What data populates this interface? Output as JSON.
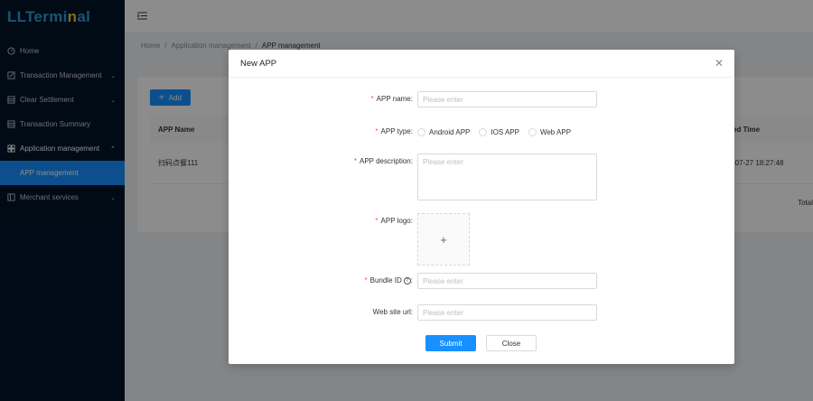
{
  "sidebar": {
    "logo_main": "LLTerminal",
    "items": [
      {
        "label": "Home",
        "icon": "dashboard-icon"
      },
      {
        "label": "Transaction Management",
        "icon": "edit-icon"
      },
      {
        "label": "Clear Settlement",
        "icon": "table-icon"
      },
      {
        "label": "Transaction Summary",
        "icon": "table-icon"
      },
      {
        "label": "Application management",
        "icon": "appstore-icon"
      },
      {
        "label": "APP management",
        "icon": ""
      },
      {
        "label": "Merchant services",
        "icon": "layout-icon"
      }
    ]
  },
  "breadcrumb": {
    "home": "Home",
    "parent": "Application management",
    "current": "APP management"
  },
  "toolbar": {
    "add_label": "Add"
  },
  "table": {
    "col_name": "APP Name",
    "col_time": "ed Time",
    "row_name": "扫码点餐111",
    "row_time": "-07-27 18:27:48",
    "total": "Total"
  },
  "modal": {
    "title": "New APP",
    "app_name_label": "APP name",
    "app_name_placeholder": "Please enter",
    "app_type_label": "APP type",
    "app_types": [
      "Android APP",
      "IOS APP",
      "Web APP"
    ],
    "description_label": "APP description",
    "description_placeholder": "Please enter",
    "logo_label": "APP logo",
    "bundle_label": "Bundle ID",
    "bundle_placeholder": "Please enter",
    "website_label": "Web site url",
    "website_placeholder": "Please enter",
    "submit_label": "Submit",
    "close_label": "Close"
  },
  "colors": {
    "accent": "#1890ff",
    "sidebar_bg": "#001529",
    "required": "#ff4d4f"
  }
}
